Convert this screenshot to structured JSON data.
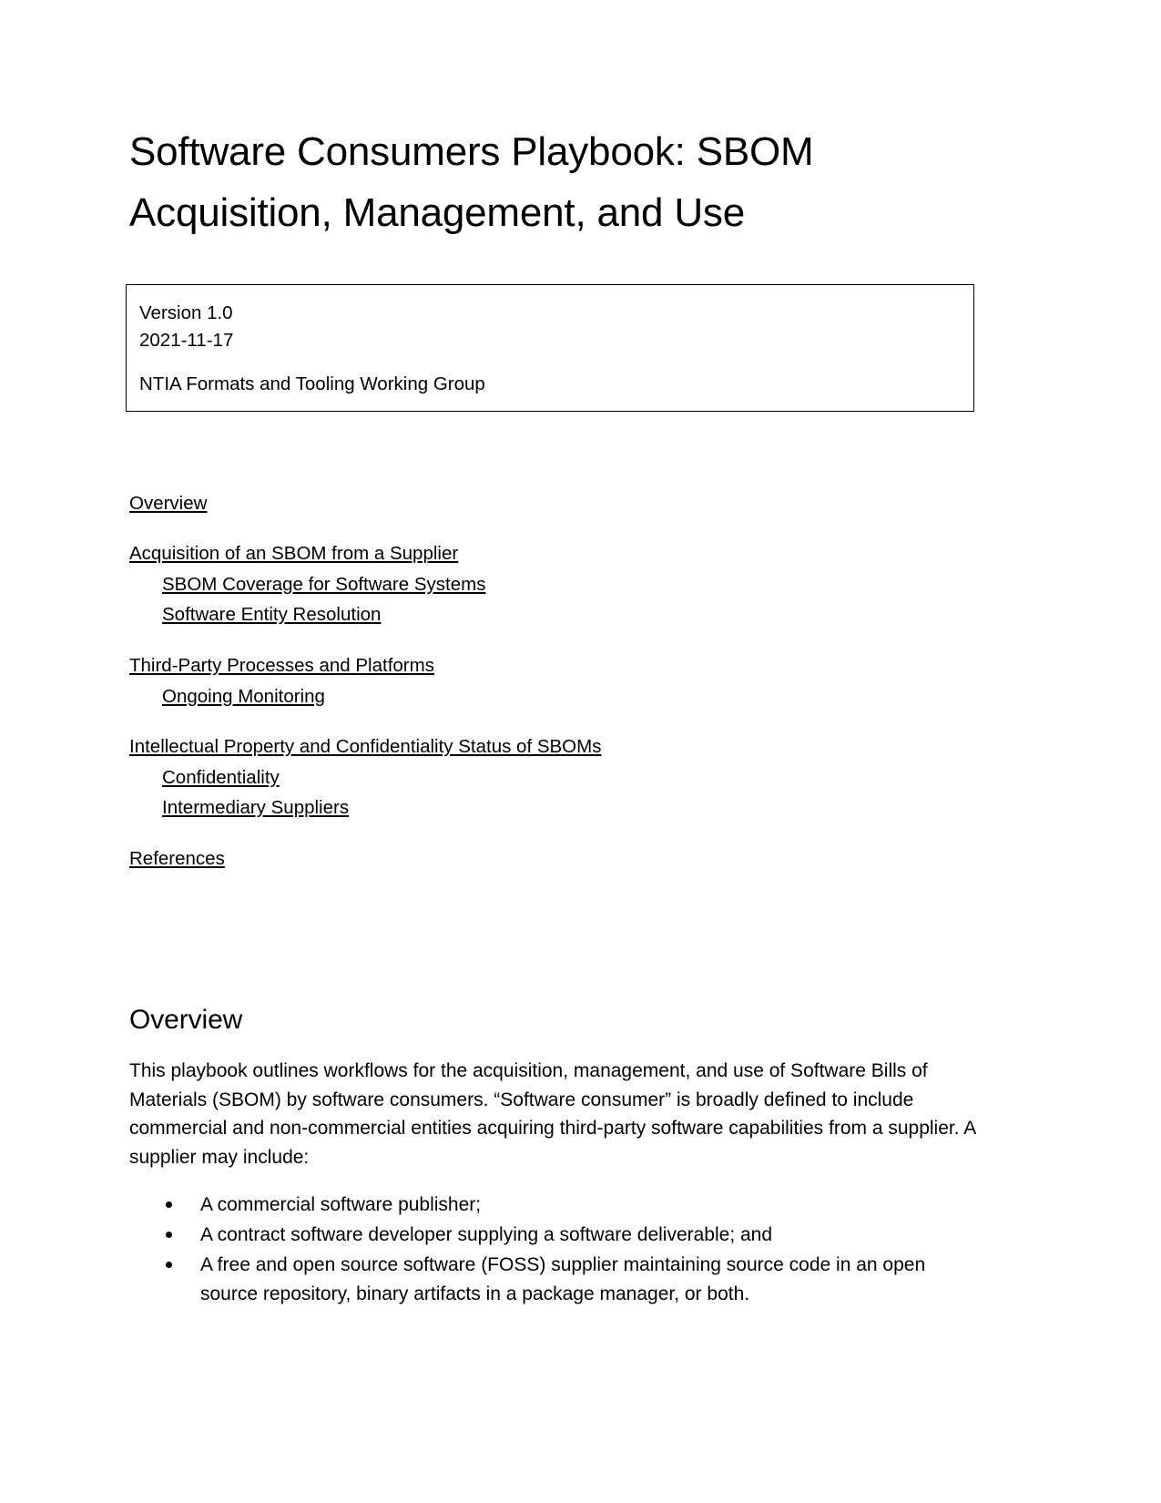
{
  "document": {
    "title": "Software Consumers Playbook: SBOM Acquisition, Management, and Use",
    "meta_box": {
      "version": "Version 1.0",
      "date": "2021-11-17",
      "organization": "NTIA Formats and Tooling Working Group"
    },
    "table_of_contents": [
      {
        "label": "Overview",
        "level": 1
      },
      {
        "label": "Acquisition of an SBOM from a Supplier",
        "level": 1
      },
      {
        "label": "SBOM Coverage for Software Systems",
        "level": 2
      },
      {
        "label": "Software Entity Resolution",
        "level": 2
      },
      {
        "label": "Third-Party Processes and Platforms",
        "level": 1
      },
      {
        "label": "Ongoing Monitoring",
        "level": 2
      },
      {
        "label": "Intellectual Property and Confidentiality Status of SBOMs",
        "level": 1
      },
      {
        "label": "Confidentiality",
        "level": 2
      },
      {
        "label": "Intermediary Suppliers",
        "level": 2
      },
      {
        "label": "References",
        "level": 1
      }
    ],
    "sections": [
      {
        "heading": "Overview",
        "paragraph": "This playbook outlines workflows for the acquisition, management, and use of Software Bills of Materials (SBOM) by software consumers. “Software consumer” is broadly defined to include commercial and non-commercial entities acquiring third-party software capabilities from a supplier. A supplier may include:",
        "bullets": [
          "A commercial software publisher;",
          "A contract software developer supplying a software deliverable; and",
          "A free and open source software (FOSS) supplier maintaining source code in an open source repository, binary artifacts in a package manager, or both."
        ]
      }
    ]
  }
}
